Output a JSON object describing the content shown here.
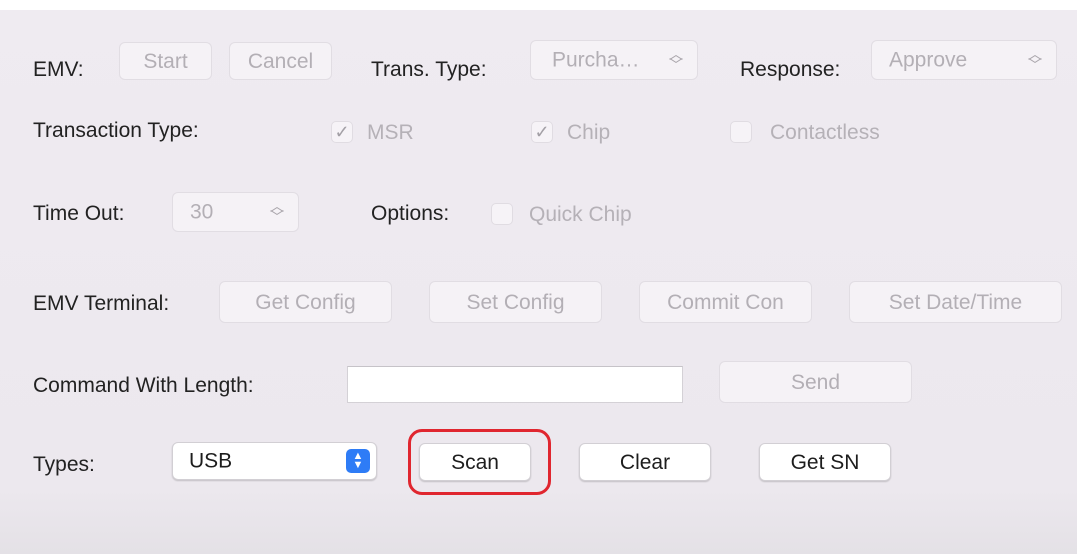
{
  "emv_row": {
    "label": "EMV:",
    "start_label": "Start",
    "cancel_label": "Cancel",
    "trans_type_label": "Trans. Type:",
    "trans_type_value": "Purcha…",
    "response_label": "Response:",
    "response_value": "Approve"
  },
  "transaction_type_row": {
    "label": "Transaction Type:",
    "options": [
      {
        "label": "MSR",
        "checked": true
      },
      {
        "label": "Chip",
        "checked": true
      },
      {
        "label": "Contactless",
        "checked": false
      }
    ]
  },
  "timeout_row": {
    "label": "Time Out:",
    "value": "30",
    "options_label": "Options:",
    "quick_chip_label": "Quick Chip",
    "quick_chip_checked": false
  },
  "emv_terminal_row": {
    "label": "EMV Terminal:",
    "get_config_label": "Get Config",
    "set_config_label": "Set Config",
    "commit_con_label": "Commit Con",
    "set_datetime_label": "Set Date/Time"
  },
  "command_row": {
    "label": "Command With Length:",
    "input_value": "",
    "send_label": "Send"
  },
  "types_row": {
    "label": "Types:",
    "selected_type": "USB",
    "scan_label": "Scan",
    "clear_label": "Clear",
    "get_sn_label": "Get SN"
  },
  "colors": {
    "highlight": "#e0262f",
    "popup_accent": "#2e7cf6",
    "panel_background": "#efebf1"
  }
}
